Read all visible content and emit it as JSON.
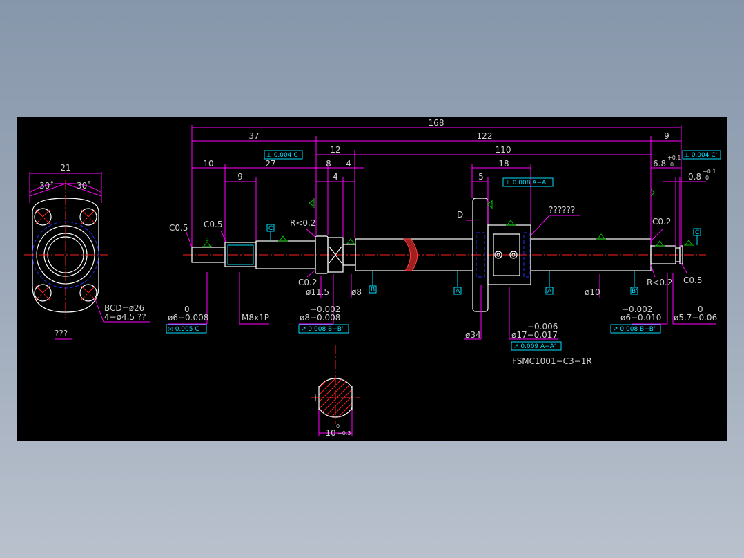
{
  "drawing": {
    "dims": {
      "d168": "168",
      "d37": "37",
      "d122": "122",
      "d9": "9",
      "d12": "12",
      "d110": "110",
      "d10": "10",
      "d27": "27",
      "d8": "8",
      "d4a": "4",
      "d4b": "4",
      "d9b": "9",
      "d18": "18",
      "d5": "5",
      "d21": "21",
      "d6_8": "6.8",
      "d6_8_tol_up": "+0.1",
      "d6_8_tol_lo": "0",
      "d0_8": "0.8",
      "d0_8_tol_up": "+0.1",
      "d0_8_tol_lo": "0"
    },
    "angles": {
      "left": "30˚",
      "right": "30˚"
    },
    "chamfers": {
      "c05_left": "C0.5",
      "c05_thread": "C0.5",
      "r02_top": "R<0.2",
      "c02_bottom": "C0.2",
      "c02_right": "C0.2",
      "r02_right": "R<0.2",
      "c05_right": "C0.5"
    },
    "diameters": {
      "d11_5": "ø11.5",
      "d8": "ø8",
      "d34": "ø34",
      "d10": "ø10",
      "d6_left_tol": "0",
      "d6_left": "ø6−0.008",
      "thread": "M8x1P",
      "d8_tol_top": "−0.002",
      "d8_main": "ø8−0.008",
      "d17_tol_top": "−0.006",
      "d17_main": "ø17−0.017",
      "d6_right_tol": "−0.002",
      "d6_right": "ø6−0.010",
      "d5_7_tol": "0",
      "d5_7": "ø5.7−0.06"
    },
    "flange": {
      "bcd": "BCD=ø26",
      "holes": "4−ø4.5 ??",
      "caption": "???"
    },
    "callout": "??????",
    "gdt": {
      "perp_c_top": "⊥ 0.004 C",
      "perp_c_right": "⊥ 0.004 C'",
      "perp_aa": "⊥ 0.008 A−A'",
      "conc_c": "◎ 0.005 C",
      "runout_bb_left": "↗ 0.008 B−B'",
      "runout_aa": "↗ 0.009 A−A'",
      "runout_bb_right": "↗ 0.008 B−B'"
    },
    "datums": {
      "c1": "C",
      "c2": "C",
      "b1": "B",
      "a1": "A",
      "a2": "A",
      "b2": "B'"
    },
    "label_d": "D",
    "surface_mark": "G",
    "part_number": "FSMC1001−C3−1R",
    "section": {
      "width": "10",
      "tol_up": "0",
      "tol_lo": "−0.3"
    }
  }
}
